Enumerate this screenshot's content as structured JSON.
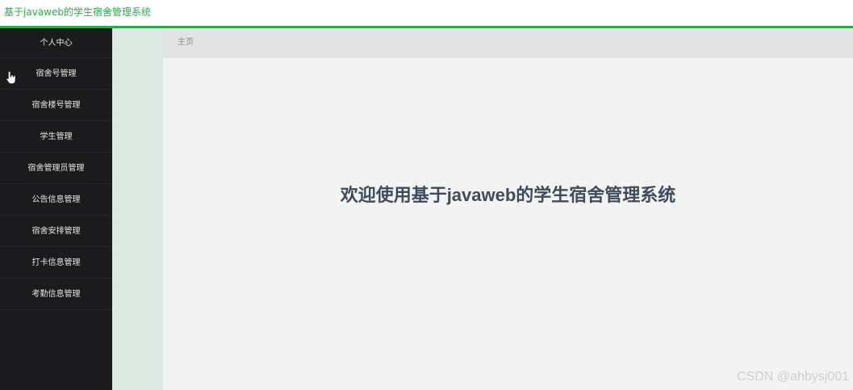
{
  "header": {
    "title": "基于javaweb的学生宿舍管理系统"
  },
  "sidebar": {
    "items": [
      {
        "label": "个人中心"
      },
      {
        "label": "宿舍号管理"
      },
      {
        "label": "宿舍楼号管理"
      },
      {
        "label": "学生管理"
      },
      {
        "label": "宿舍管理员管理"
      },
      {
        "label": "公告信息管理"
      },
      {
        "label": "宿舍安排管理"
      },
      {
        "label": "打卡信息管理"
      },
      {
        "label": "考勤信息管理"
      }
    ]
  },
  "breadcrumb": {
    "home": "主页"
  },
  "main": {
    "welcome_text": "欢迎使用基于javaweb的学生宿舍管理系统"
  },
  "watermark": "CSDN @ahbysj001",
  "colors": {
    "accent_green": "#2fa84f",
    "sidebar_bg": "#1b1b1d",
    "welcome_text": "#3f4b5b"
  },
  "icons": {
    "cursor": "hand-pointer-icon"
  }
}
